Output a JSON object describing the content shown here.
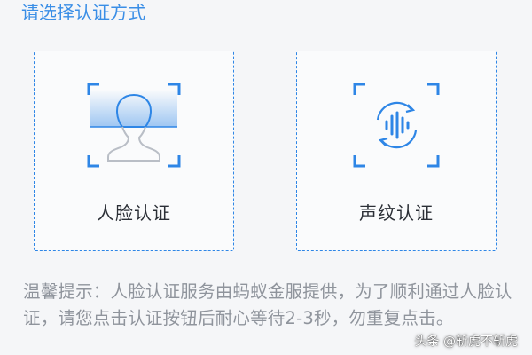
{
  "page": {
    "title": "请选择认证方式",
    "accent_color": "#2e86e6"
  },
  "options": [
    {
      "label": "人脸认证",
      "icon": "face-scan-icon"
    },
    {
      "label": "声纹认证",
      "icon": "voiceprint-icon"
    }
  ],
  "hint": {
    "text": "温馨提示：人脸认证服务由蚂蚁金服提供，为了顺利通过人脸认证，请您点击认证按钮后耐心等待2-3秒，勿重复点击。"
  },
  "watermark": {
    "text": "头条 @斩虎不斩虎"
  }
}
